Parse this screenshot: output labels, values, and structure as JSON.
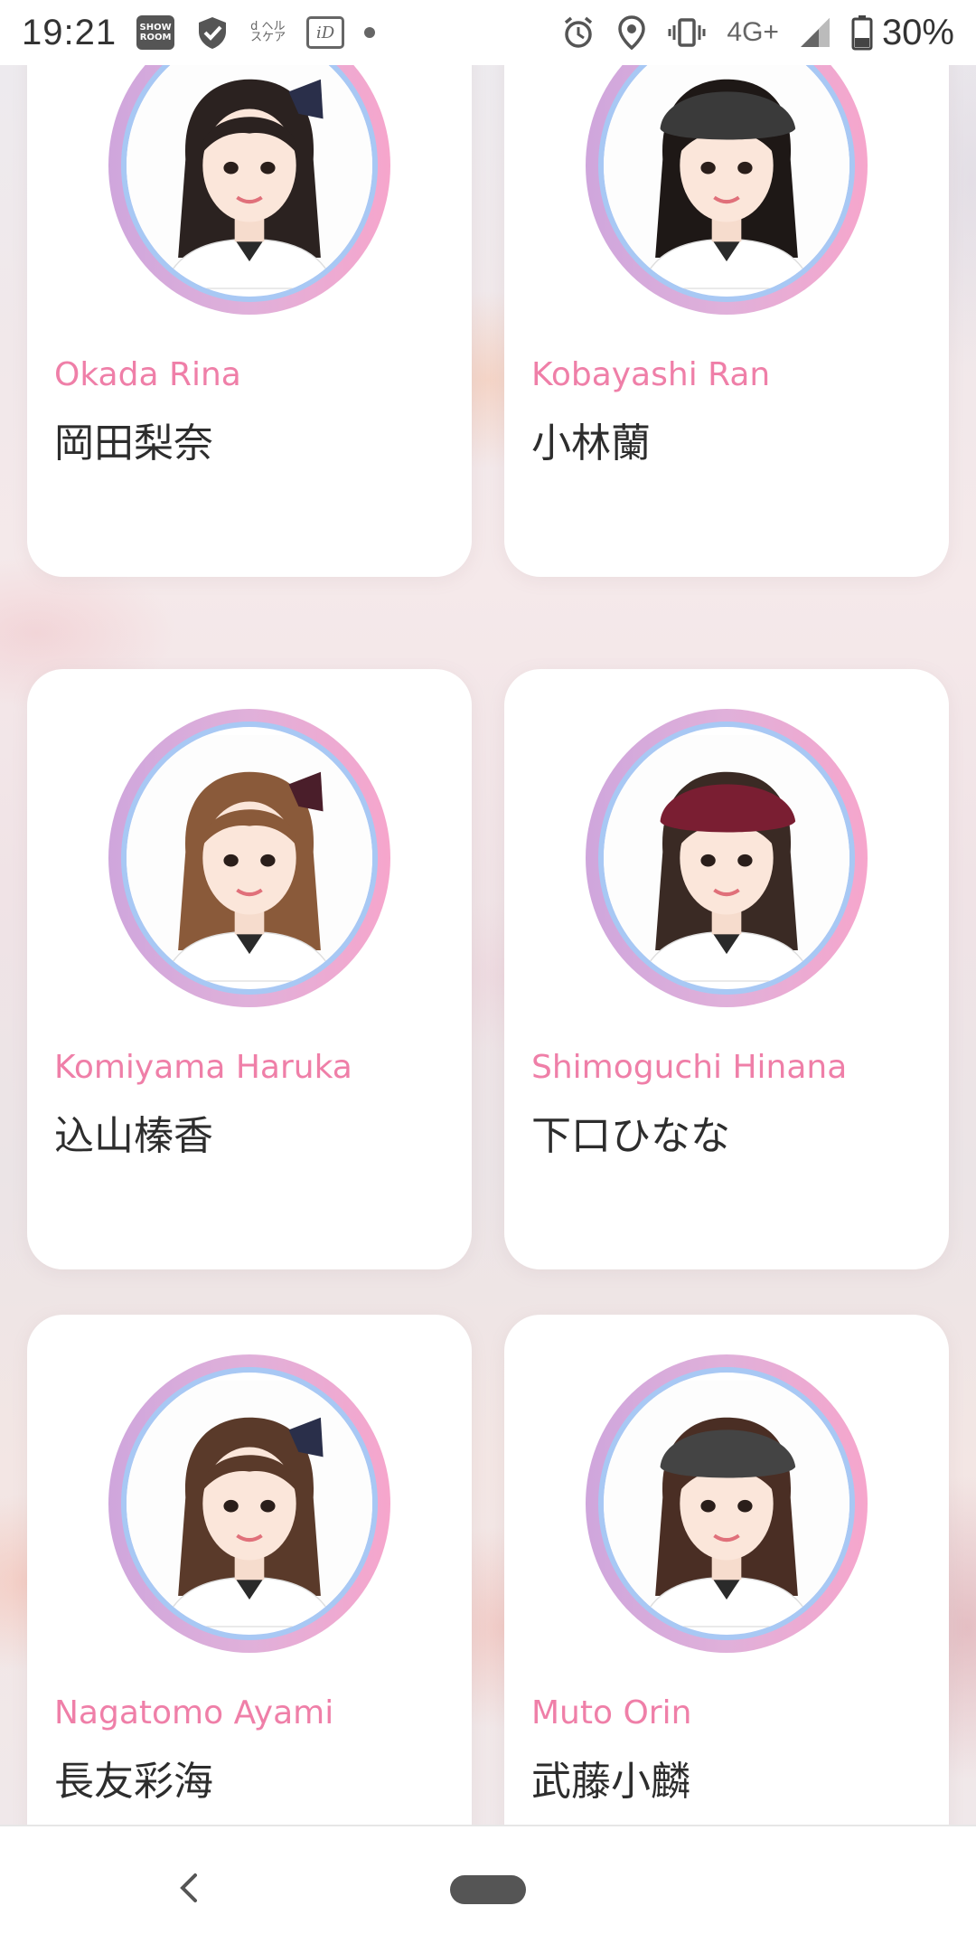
{
  "status_bar": {
    "time": "19:21",
    "icons_left": [
      "showroom-icon",
      "shield-check-icon",
      "d-health-care-icon",
      "id-icon",
      "dot-icon"
    ],
    "showroom_label": "SHOW ROOM",
    "dcare_label": "d ヘルスケア",
    "id_label": "iD",
    "icons_right": [
      "alarm-icon",
      "location-icon",
      "vibrate-icon",
      "signal-icon",
      "battery-icon"
    ],
    "network": "4G+",
    "battery": "30%"
  },
  "members": [
    {
      "name_en": "Okada Rina",
      "name_jp": "岡田梨奈",
      "hair": "#2b2220",
      "hat": "none",
      "ribbon": "#2a2f4a"
    },
    {
      "name_en": "Kobayashi Ran",
      "name_jp": "小林蘭",
      "hair": "#1e1816",
      "hat": "#3a3a3a",
      "ribbon": "none"
    },
    {
      "name_en": "Komiyama Haruka",
      "name_jp": "込山榛香",
      "hair": "#8a5a3a",
      "hat": "none",
      "ribbon": "#4a1e2a"
    },
    {
      "name_en": "Shimoguchi Hinana",
      "name_jp": "下口ひなな",
      "hair": "#3a2a24",
      "hat": "#7a1e32",
      "ribbon": "none"
    },
    {
      "name_en": "Nagatomo Ayami",
      "name_jp": "長友彩海",
      "hair": "#5a3a2a",
      "hat": "none",
      "ribbon": "#2a2f4a"
    },
    {
      "name_en": "Muto Orin",
      "name_jp": "武藤小麟",
      "hair": "#4a2e24",
      "hat": "#444444",
      "ribbon": "none"
    }
  ],
  "nav": {
    "icons": [
      "back-chevron-icon",
      "home-pill-icon"
    ]
  },
  "colors": {
    "accent_pink": "#ef7fa8",
    "ring_gradient": [
      "#cfa6dc",
      "#f6a6cc"
    ],
    "ring_inner": "#a8c8f4"
  }
}
